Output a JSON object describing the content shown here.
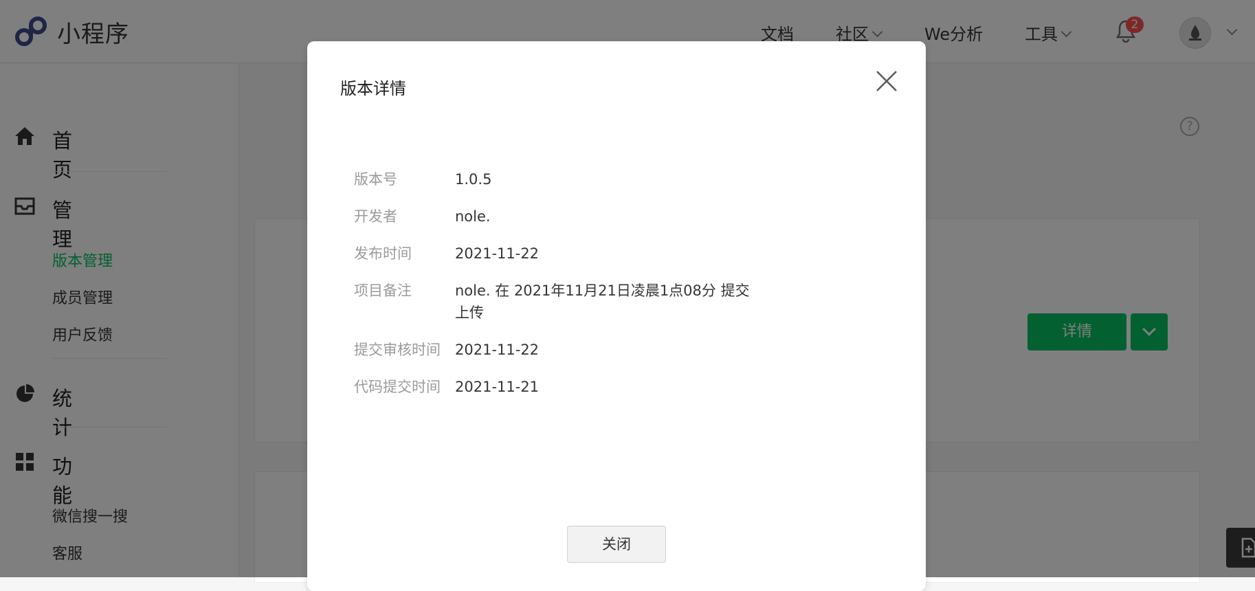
{
  "header": {
    "brand": "小程序",
    "nav": [
      {
        "label": "文档",
        "has_dropdown": false
      },
      {
        "label": "社区",
        "has_dropdown": true
      },
      {
        "label": "We分析",
        "has_dropdown": false
      },
      {
        "label": "工具",
        "has_dropdown": true
      }
    ],
    "notification_count": "2",
    "avatar_icon": "avatar-icon"
  },
  "sidebar": {
    "sections": [
      {
        "label": "首页",
        "icon": "home-icon"
      },
      {
        "label": "管理",
        "icon": "inbox-icon",
        "items": [
          "版本管理",
          "成员管理",
          "用户反馈"
        ],
        "active_item": "版本管理"
      },
      {
        "label": "统计",
        "icon": "pie-chart-icon"
      },
      {
        "label": "功能",
        "icon": "grid-icon",
        "items": [
          "微信搜一搜",
          "客服"
        ]
      }
    ]
  },
  "main": {
    "detail_button": "详情",
    "help_glyph": "?"
  },
  "modal": {
    "title": "版本详情",
    "rows": [
      {
        "label": "版本号",
        "value": "1.0.5"
      },
      {
        "label": "开发者",
        "value": "nole."
      },
      {
        "label": "发布时间",
        "value": "2021-11-22"
      },
      {
        "label": "项目备注",
        "value": "nole. 在 2021年11月21日凌晨1点08分 提交上传"
      },
      {
        "label": "提交审核时间",
        "value": "2021-11-22"
      },
      {
        "label": "代码提交时间",
        "value": "2021-11-21"
      }
    ],
    "close_button": "关闭"
  },
  "colors": {
    "accent": "#07c160",
    "badge": "#fa5151",
    "logo": "#3d4a8f"
  }
}
